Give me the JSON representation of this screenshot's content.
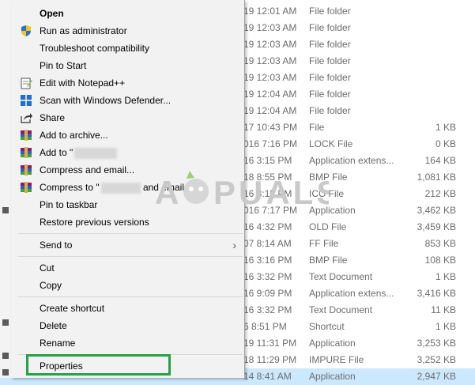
{
  "files": [
    {
      "date": "19 12:01 AM",
      "type": "File folder",
      "size": ""
    },
    {
      "date": "19 12:03 AM",
      "type": "File folder",
      "size": ""
    },
    {
      "date": "19 12:03 AM",
      "type": "File folder",
      "size": ""
    },
    {
      "date": "19 12:03 AM",
      "type": "File folder",
      "size": ""
    },
    {
      "date": "19 12:03 AM",
      "type": "File folder",
      "size": ""
    },
    {
      "date": "19 12:04 AM",
      "type": "File folder",
      "size": ""
    },
    {
      "date": "19 12:04 AM",
      "type": "File folder",
      "size": ""
    },
    {
      "date": "17 10:43 PM",
      "type": "File",
      "size": "1 KB"
    },
    {
      "date": "016 7:16 PM",
      "type": "LOCK File",
      "size": "0 KB"
    },
    {
      "date": "16 3:15 PM",
      "type": "Application extens...",
      "size": "164 KB"
    },
    {
      "date": "18 8:55 PM",
      "type": "BMP File",
      "size": "1,081 KB"
    },
    {
      "date": "16 3:15 PM",
      "type": "ICO File",
      "size": "212 KB"
    },
    {
      "date": "016 7:17 PM",
      "type": "Application",
      "size": "3,462 KB"
    },
    {
      "date": "16 4:32 PM",
      "type": "OLD File",
      "size": "3,459 KB"
    },
    {
      "date": "07 8:14 AM",
      "type": "FF File",
      "size": "853 KB"
    },
    {
      "date": "16 3:16 PM",
      "type": "BMP File",
      "size": "108 KB"
    },
    {
      "date": "16 3:32 PM",
      "type": "Text Document",
      "size": "1 KB"
    },
    {
      "date": "16 9:09 PM",
      "type": "Application extens...",
      "size": "3,416 KB"
    },
    {
      "date": "16 3:32 PM",
      "type": "Text Document",
      "size": "11 KB"
    },
    {
      "date": "6 8:51 PM",
      "type": "Shortcut",
      "size": "1 KB"
    },
    {
      "date": "19 11:31 PM",
      "type": "Application",
      "size": "3,253 KB"
    },
    {
      "date": "18 11:29 PM",
      "type": "IMPURE File",
      "size": "3,252 KB"
    },
    {
      "date": "14 8:41 AM",
      "type": "Application",
      "size": "2,947 KB"
    }
  ],
  "menu": {
    "open": "Open",
    "run_as_admin": "Run as administrator",
    "troubleshoot": "Troubleshoot compatibility",
    "pin_start": "Pin to Start",
    "edit_notepad": "Edit with Notepad++",
    "scan_defender": "Scan with Windows Defender...",
    "share": "Share",
    "add_archive": "Add to archive...",
    "add_to": "Add to \"",
    "compress_email": "Compress and email...",
    "compress_to": "Compress to \"",
    "compress_to_suffix": " and email",
    "pin_taskbar": "Pin to taskbar",
    "restore_versions": "Restore previous versions",
    "send_to": "Send to",
    "cut": "Cut",
    "copy": "Copy",
    "create_shortcut": "Create shortcut",
    "delete": "Delete",
    "rename": "Rename",
    "properties": "Properties"
  },
  "icons": {
    "uac_shield": "uac-shield-icon",
    "notepad": "notepad-plus-plus-icon",
    "defender": "windows-defender-icon",
    "share": "share-icon",
    "winrar": "winrar-archive-icon"
  },
  "colors": {
    "menu_bg": "#f2f2f2",
    "highlight_border": "#25a244",
    "selected_row": "#cce8ff",
    "secondary_text": "#6d6d6d"
  },
  "watermark": "APPUALS"
}
